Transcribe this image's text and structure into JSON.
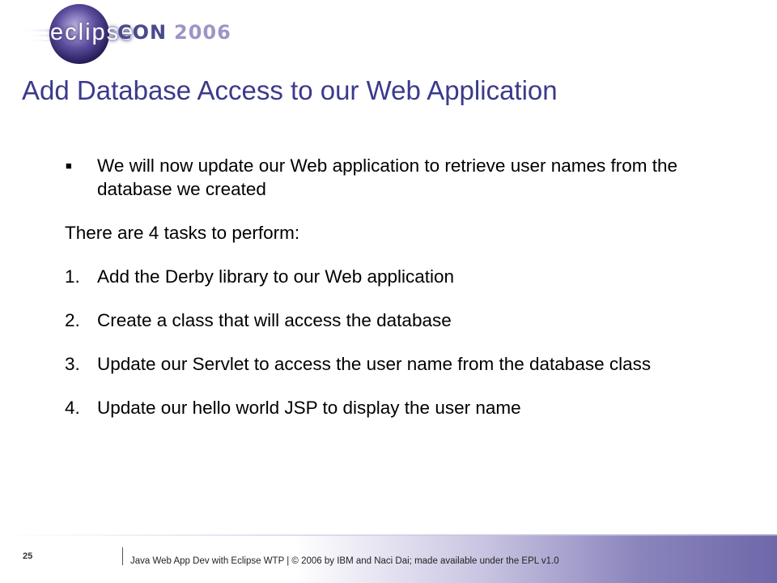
{
  "logo": {
    "word": "eclipse",
    "con": "CON",
    "year": "2006"
  },
  "title": "Add Database Access to our Web Application",
  "bullet": {
    "marker": "■",
    "text": "We will now update our Web application to retrieve user names from the database we created"
  },
  "intro": "There are 4 tasks to perform:",
  "tasks": [
    {
      "num": "1.",
      "text": "Add the Derby library to our Web application"
    },
    {
      "num": "2.",
      "text": "Create a class that will access the database"
    },
    {
      "num": "3.",
      "text": "Update our Servlet to access the user name from the database class"
    },
    {
      "num": "4.",
      "text": "Update our hello world JSP to display the user name"
    }
  ],
  "footer": {
    "page_number": "25",
    "text": "Java Web App Dev with Eclipse WTP  |  © 2006 by IBM and Naci Dai; made available under the EPL v1.0"
  }
}
